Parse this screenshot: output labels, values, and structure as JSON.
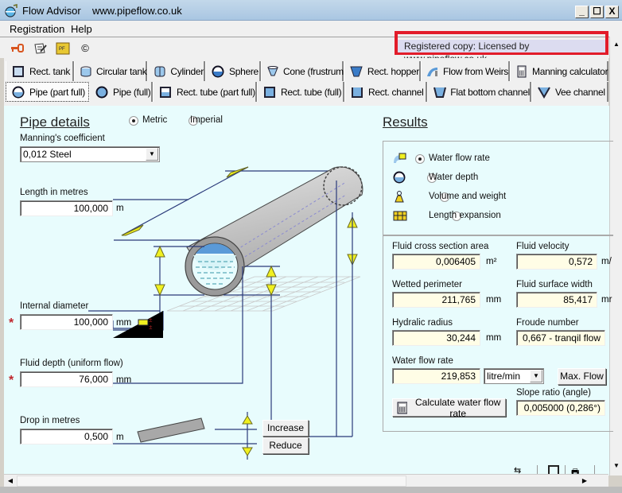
{
  "window": {
    "title": "Flow Advisor",
    "url": "www.pipeflow.co.uk",
    "minimize": "_",
    "maximize": "☐",
    "close": "X"
  },
  "menu": [
    "Registration",
    "Help"
  ],
  "toolbar": {
    "icons": [
      "key-icon",
      "register-pencil-icon",
      "pipeflow-book-icon",
      "copyright-icon"
    ],
    "copyright_glyph": "©",
    "registration_status": "Registered copy: Licensed by www.pipeflow.co.uk"
  },
  "tabs_row1": [
    {
      "label": "Rect. tank",
      "icon": "rect-tank-icon"
    },
    {
      "label": "Circular tank",
      "icon": "circular-tank-icon"
    },
    {
      "label": "Cylinder",
      "icon": "cylinder-icon"
    },
    {
      "label": "Sphere",
      "icon": "sphere-icon"
    },
    {
      "label": "Cone (frustrum)",
      "icon": "cone-icon"
    },
    {
      "label": "Rect. hopper",
      "icon": "hopper-icon"
    },
    {
      "label": "Flow from Weirs",
      "icon": "weir-icon"
    },
    {
      "label": "Manning calculator",
      "icon": "calculator-icon"
    }
  ],
  "tabs_row2": [
    {
      "label": "Pipe (part full)",
      "icon": "pipe-part-full-icon",
      "active": true
    },
    {
      "label": "Pipe (full)",
      "icon": "pipe-full-icon"
    },
    {
      "label": "Rect. tube (part full)",
      "icon": "rect-tube-part-icon"
    },
    {
      "label": "Rect. tube (full)",
      "icon": "rect-tube-full-icon"
    },
    {
      "label": "Rect. channel",
      "icon": "rect-channel-icon"
    },
    {
      "label": "Flat bottom channel",
      "icon": "flat-bottom-channel-icon"
    },
    {
      "label": "Vee channel",
      "icon": "vee-channel-icon"
    }
  ],
  "pipe_details": {
    "heading": "Pipe details",
    "units": {
      "metric": "Metric",
      "imperial": "Imperial",
      "selected": "Metric"
    },
    "manning": {
      "label": "Manning's coefficient",
      "value": "0,012  Steel"
    },
    "length": {
      "label": "Length  in metres",
      "value": "100,000",
      "unit": "m"
    },
    "internal_diameter": {
      "label": "Internal diameter",
      "value": "100,000",
      "unit": "mm",
      "required": "*"
    },
    "fluid_depth": {
      "label": "Fluid depth (uniform flow)",
      "value": "76,000",
      "unit": "mm",
      "required": "*"
    },
    "drop": {
      "label": "Drop  in metres",
      "value": "0,500",
      "unit": "m"
    },
    "increase_label": "Increase",
    "reduce_label": "Reduce"
  },
  "results": {
    "heading": "Results",
    "modes": [
      {
        "label": "Water flow rate",
        "icon": "flow-rate-icon",
        "selected": true
      },
      {
        "label": "Water depth",
        "icon": "water-depth-icon",
        "selected": false
      },
      {
        "label": "Volume and weight",
        "icon": "weight-icon",
        "selected": false
      },
      {
        "label": "Length expansion",
        "icon": "length-expansion-icon",
        "selected": false
      }
    ],
    "cross_section_area": {
      "label": "Fluid cross section area",
      "value": "0,006405",
      "unit": "m²"
    },
    "velocity": {
      "label": "Fluid velocity",
      "value": "0,572",
      "unit": "m/"
    },
    "wetted_perimeter": {
      "label": "Wetted perimeter",
      "value": "211,765",
      "unit": "mm"
    },
    "surface_width": {
      "label": "Fluid surface width",
      "value": "85,417",
      "unit": "mr"
    },
    "hydraulic_radius": {
      "label": "Hydralic radius",
      "value": "30,244",
      "unit": "mm"
    },
    "froude": {
      "label": "Froude number",
      "value": "0,667 - tranqil flow"
    },
    "flow_rate": {
      "label": "Water flow rate",
      "value": "219,853",
      "unit_selected": "litre/min"
    },
    "max_flow_label": "Max. Flow",
    "slope": {
      "label": "Slope ratio (angle)",
      "value": "0,005000 (0,286°)"
    },
    "calculate_label": "Calculate water flow rate"
  }
}
